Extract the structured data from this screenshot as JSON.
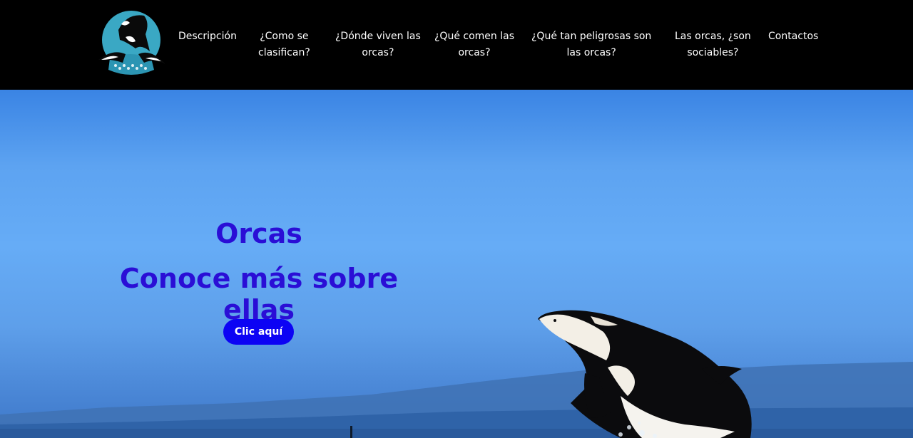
{
  "nav": {
    "logo_icon": "orca-logo-icon",
    "items": [
      {
        "label": "Descripción"
      },
      {
        "label": "¿Como se\nclasifican?"
      },
      {
        "label": "¿Dónde viven las\norcas?"
      },
      {
        "label": "¿Qué comen las\norcas?"
      },
      {
        "label": "¿Qué tan peligrosas son\nlas orcas?"
      },
      {
        "label": "Las orcas, ¿son\nsociables?"
      },
      {
        "label": "Contactos"
      }
    ]
  },
  "hero": {
    "title": "Orcas",
    "subtitle": "Conoce más sobre ellas",
    "button_label": "Clic aquí",
    "image": "breaching-orca-photo"
  },
  "colors": {
    "nav_background": "#000000",
    "nav_text": "#ffffff",
    "hero_text": "#2a0ed6",
    "button_background": "#0c03f4",
    "button_text": "#ffffff"
  }
}
